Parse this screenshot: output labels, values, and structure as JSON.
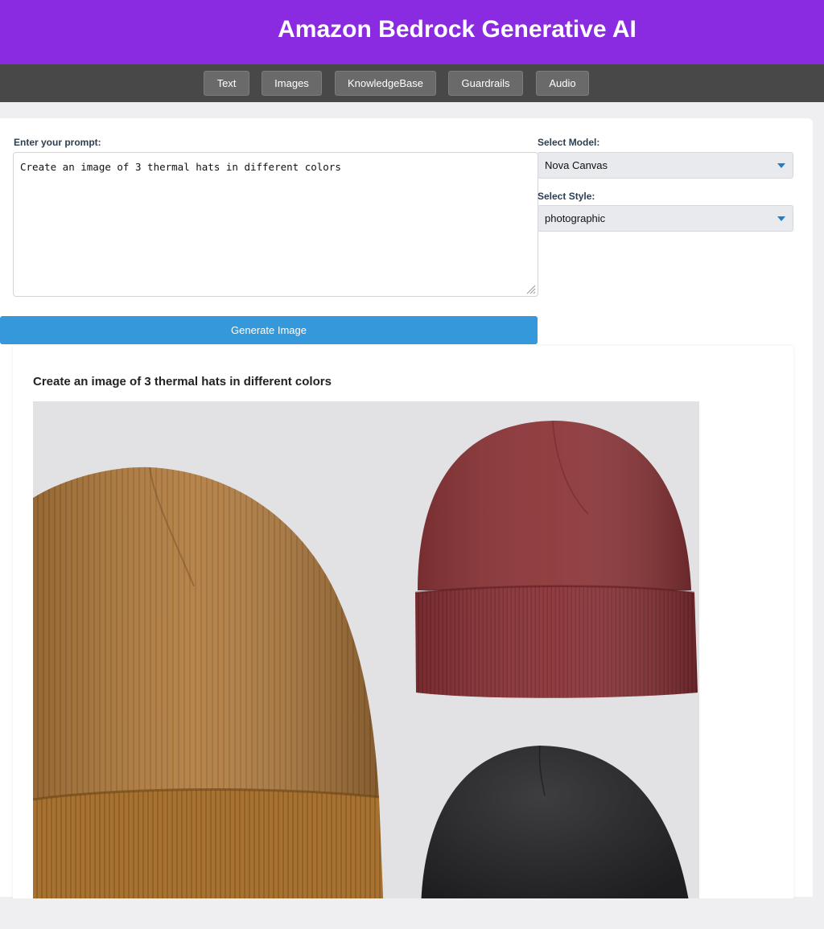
{
  "header": {
    "title": "Amazon Bedrock Generative AI",
    "background": "#8a2be2"
  },
  "nav": {
    "items": [
      {
        "label": "Text"
      },
      {
        "label": "Images"
      },
      {
        "label": "KnowledgeBase"
      },
      {
        "label": "Guardrails"
      },
      {
        "label": "Audio"
      }
    ]
  },
  "prompt": {
    "label": "Enter your prompt:",
    "value": "Create an image of 3 thermal hats in different colors"
  },
  "model": {
    "label": "Select Model:",
    "selected": "Nova Canvas"
  },
  "style": {
    "label": "Select Style:",
    "selected": "photographic"
  },
  "generate": {
    "label": "Generate Image",
    "color": "#3498db"
  },
  "result": {
    "title": "Create an image of 3 thermal hats in different colors",
    "image": {
      "hats": [
        {
          "name": "tan-beanie",
          "color": "#b07a3c"
        },
        {
          "name": "maroon-beanie",
          "color": "#8c3538"
        },
        {
          "name": "black-beanie",
          "color": "#2b2b2d"
        }
      ]
    }
  }
}
